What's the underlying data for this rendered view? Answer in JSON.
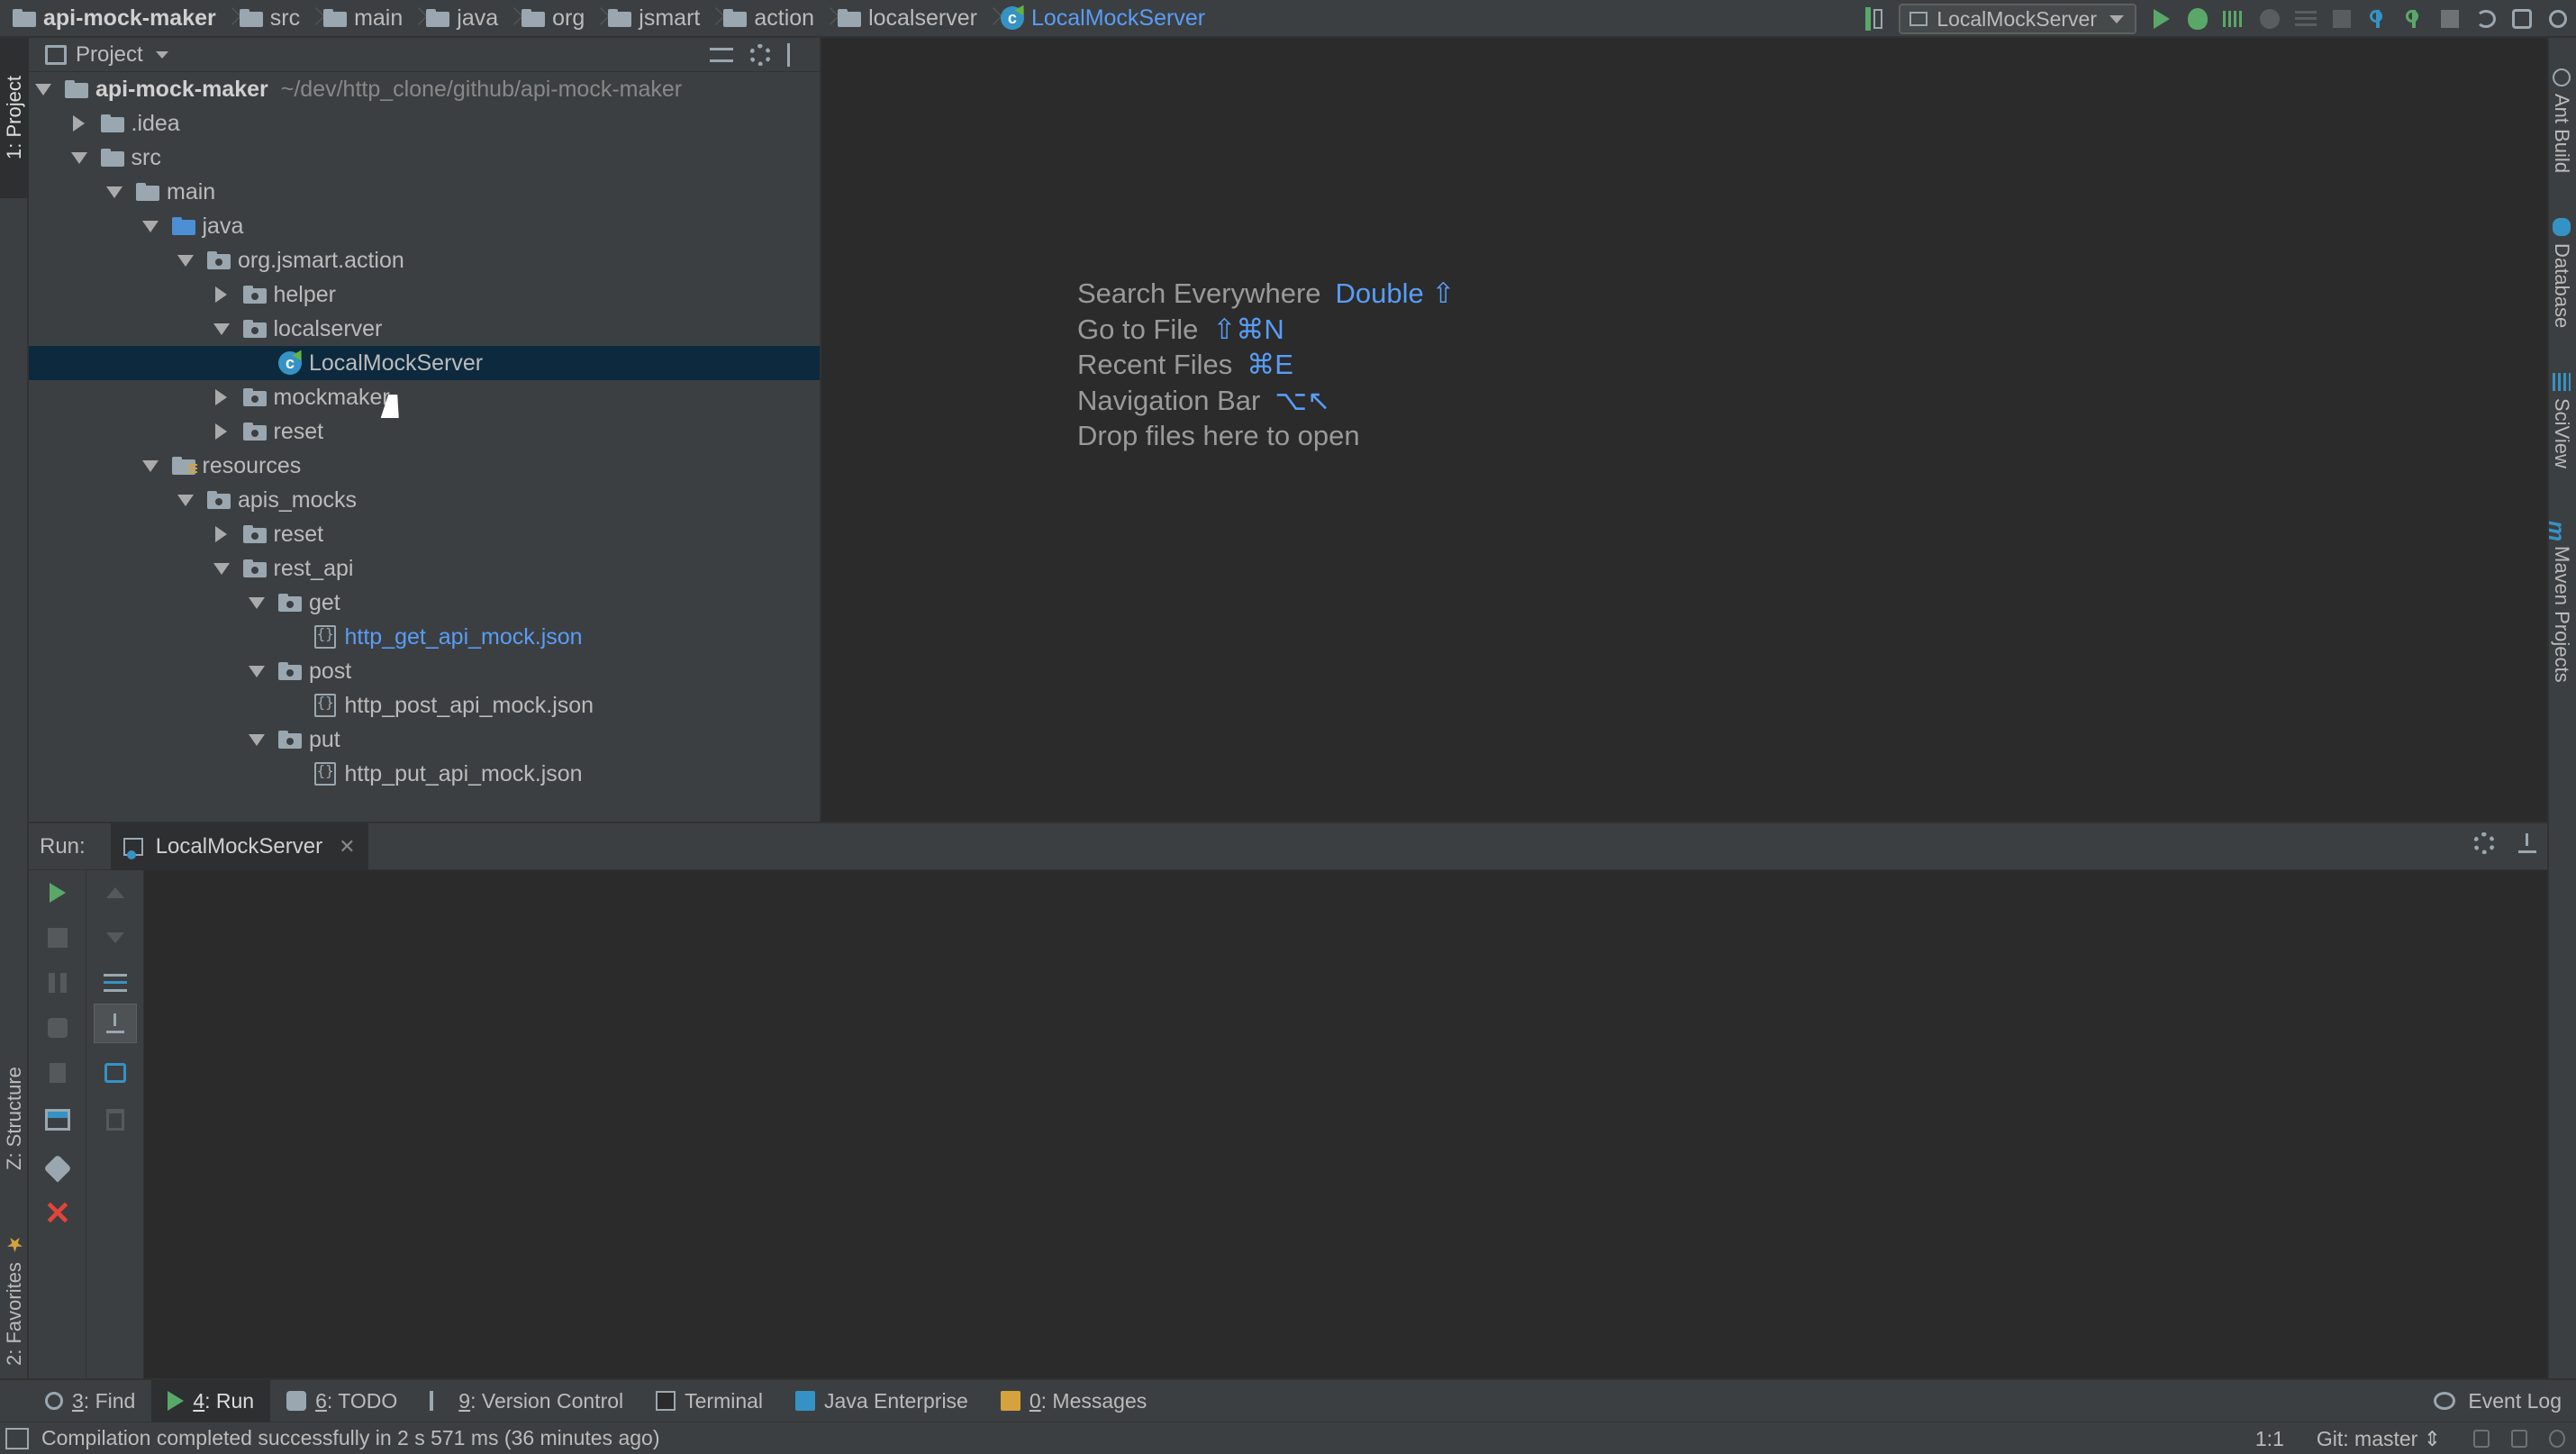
{
  "breadcrumbs": [
    {
      "label": "api-mock-maker",
      "icon": "folder-icon",
      "bold": true
    },
    {
      "label": "src",
      "icon": "folder-icon"
    },
    {
      "label": "main",
      "icon": "folder-icon"
    },
    {
      "label": "java",
      "icon": "folder-icon"
    },
    {
      "label": "org",
      "icon": "package-icon"
    },
    {
      "label": "jsmart",
      "icon": "package-icon"
    },
    {
      "label": "action",
      "icon": "package-icon"
    },
    {
      "label": "localserver",
      "icon": "package-icon"
    },
    {
      "label": "LocalMockServer",
      "icon": "class-icon",
      "active": true
    }
  ],
  "toolbar": {
    "run_config": "LocalMockServer"
  },
  "left_strip": {
    "project_tab": "1: Project",
    "structure_tab": "Z: Structure",
    "favorites_tab": "2: Favorites"
  },
  "right_strip": {
    "ant_build": "Ant Build",
    "database": "Database",
    "sciview": "SciView",
    "maven": "Maven Projects"
  },
  "project_panel": {
    "title": "Project",
    "tree": [
      {
        "label": "api-mock-maker",
        "path": "~/dev/http_clone/github/api-mock-maker",
        "depth": 0,
        "expand": "down",
        "icon": "module-folder",
        "bold": true
      },
      {
        "label": ".idea",
        "depth": 1,
        "expand": "right",
        "icon": "folder"
      },
      {
        "label": "src",
        "depth": 1,
        "expand": "down",
        "icon": "folder"
      },
      {
        "label": "main",
        "depth": 2,
        "expand": "down",
        "icon": "folder"
      },
      {
        "label": "java",
        "depth": 3,
        "expand": "down",
        "icon": "source-folder"
      },
      {
        "label": "org.jsmart.action",
        "depth": 4,
        "expand": "down",
        "icon": "package"
      },
      {
        "label": "helper",
        "depth": 5,
        "expand": "right",
        "icon": "package"
      },
      {
        "label": "localserver",
        "depth": 5,
        "expand": "down",
        "icon": "package"
      },
      {
        "label": "LocalMockServer",
        "depth": 6,
        "expand": "none",
        "icon": "class",
        "selected": true
      },
      {
        "label": "mockmaker",
        "depth": 5,
        "expand": "right",
        "icon": "package"
      },
      {
        "label": "reset",
        "depth": 5,
        "expand": "right",
        "icon": "package"
      },
      {
        "label": "resources",
        "depth": 3,
        "expand": "down",
        "icon": "resources-folder"
      },
      {
        "label": "apis_mocks",
        "depth": 4,
        "expand": "down",
        "icon": "package"
      },
      {
        "label": "reset",
        "depth": 5,
        "expand": "right",
        "icon": "package"
      },
      {
        "label": "rest_api",
        "depth": 5,
        "expand": "down",
        "icon": "package"
      },
      {
        "label": "get",
        "depth": 6,
        "expand": "down",
        "icon": "package"
      },
      {
        "label": "http_get_api_mock.json",
        "depth": 7,
        "expand": "none",
        "icon": "json",
        "link": true
      },
      {
        "label": "post",
        "depth": 6,
        "expand": "down",
        "icon": "package"
      },
      {
        "label": "http_post_api_mock.json",
        "depth": 7,
        "expand": "none",
        "icon": "json"
      },
      {
        "label": "put",
        "depth": 6,
        "expand": "down",
        "icon": "package"
      },
      {
        "label": "http_put_api_mock.json",
        "depth": 7,
        "expand": "none",
        "icon": "json"
      }
    ]
  },
  "editor_hints": [
    {
      "label": "Search Everywhere",
      "shortcut": "Double ⇧"
    },
    {
      "label": "Go to File",
      "shortcut": "⇧⌘N"
    },
    {
      "label": "Recent Files",
      "shortcut": "⌘E"
    },
    {
      "label": "Navigation Bar",
      "shortcut": "⌥↖"
    },
    {
      "label": "Drop files here to open",
      "shortcut": ""
    }
  ],
  "run_panel": {
    "label": "Run:",
    "tab_label": "LocalMockServer"
  },
  "tool_windows": [
    {
      "num": "3",
      "label": ": Find",
      "icon": "find"
    },
    {
      "num": "4",
      "label": ": Run",
      "icon": "run",
      "active": true
    },
    {
      "num": "6",
      "label": ": TODO",
      "icon": "todo"
    },
    {
      "num": "9",
      "label": ": Version Control",
      "icon": "vcs"
    },
    {
      "num": "",
      "label": "Terminal",
      "icon": "term"
    },
    {
      "num": "",
      "label": "Java Enterprise",
      "icon": "je"
    },
    {
      "num": "0",
      "label": ": Messages",
      "icon": "msg"
    }
  ],
  "event_log": "Event Log",
  "status_bar": {
    "message": "Compilation completed successfully in 2 s 571 ms (36 minutes ago)",
    "position": "1:1",
    "git_branch": "Git: master ⇕"
  }
}
